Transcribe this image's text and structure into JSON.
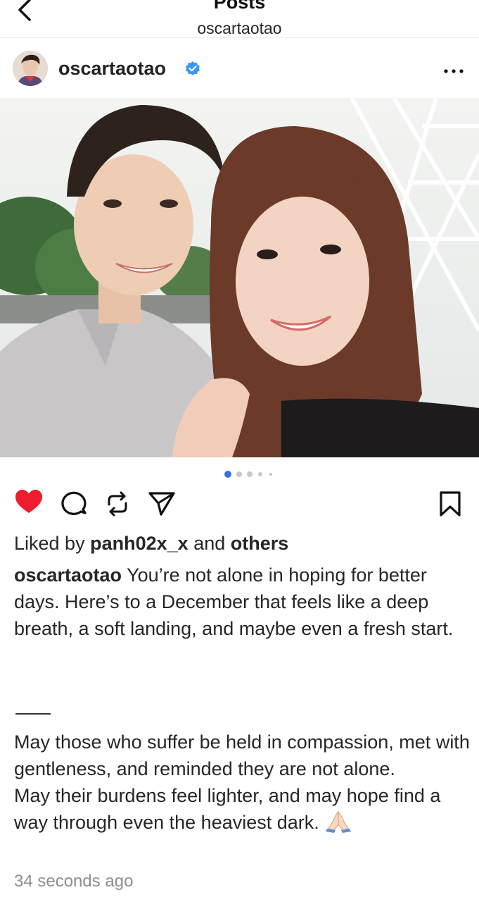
{
  "nav": {
    "title": "Posts",
    "subtitle": "oscartaotao"
  },
  "post": {
    "username": "oscartaotao",
    "verified": true,
    "media_count": 5,
    "active_index": 0,
    "liked": true,
    "likes_prefix": "Liked by",
    "likes_user": "panh02x_x",
    "likes_and": "and",
    "likes_others": "others",
    "caption_user": "oscartaotao",
    "caption_text": " You’re not alone in hoping for better days. Here’s to a December that feels like a deep breath, a soft landing, and maybe even a fresh start.",
    "caption_divider": "——",
    "caption_p2_line1": "May those who suffer be held in compassion, met with gentleness, and reminded they are not alone.",
    "caption_p2_line2": "May their burdens feel lighter, and may hope find a way through even the heaviest dark.",
    "timestamp": "34 seconds ago"
  },
  "icons": {
    "back": "chevron-left-icon",
    "verified": "verified-badge-icon",
    "more": "more-horizontal-icon",
    "like": "heart-filled-icon",
    "comment": "comment-icon",
    "repost": "repost-icon",
    "share": "send-icon",
    "save": "bookmark-icon",
    "emoji": "folded-hands-emoji"
  },
  "colors": {
    "heart": "#ed1c2e",
    "verified": "#3897f0",
    "active_dot": "#3a6ee8",
    "inactive_dot": "#c7c7c7",
    "timestamp": "#8e8e8e"
  }
}
